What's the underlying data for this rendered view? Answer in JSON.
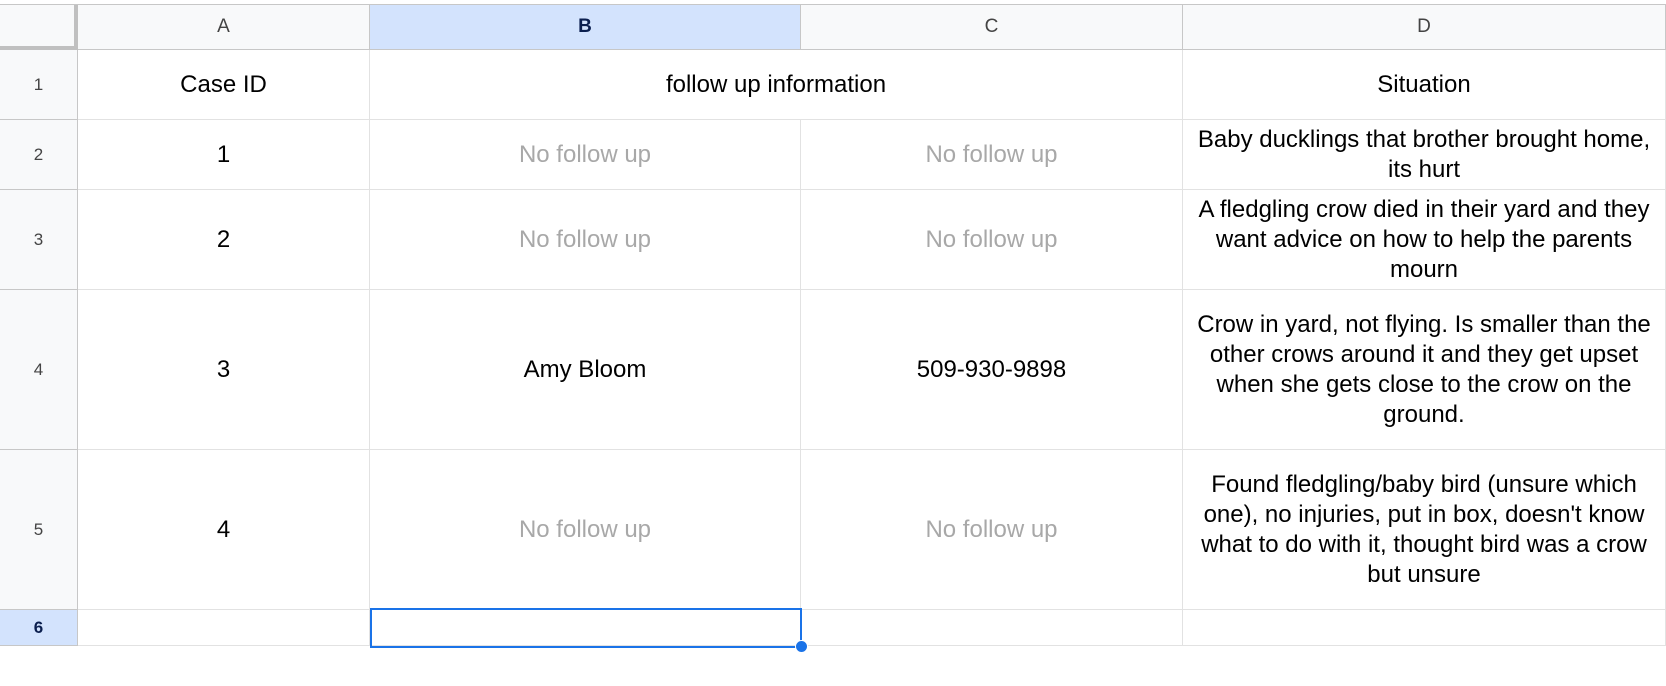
{
  "columns": [
    "A",
    "B",
    "C",
    "D"
  ],
  "rows": [
    "1",
    "2",
    "3",
    "4",
    "5",
    "6"
  ],
  "selected_column": "B",
  "selected_row": "6",
  "cells": {
    "r1": {
      "a": "Case ID",
      "bc": "follow up information",
      "d": "Situation"
    },
    "r2": {
      "a": "1",
      "b": "No follow up",
      "c": "No follow up",
      "d": "Baby ducklings that brother brought home, its hurt"
    },
    "r3": {
      "a": "2",
      "b": "No follow up",
      "c": "No follow up",
      "d": "A fledgling crow died in their yard and they want advice on how to help the parents mourn"
    },
    "r4": {
      "a": "3",
      "b": "Amy Bloom",
      "c": "509-930-9898",
      "d": "Crow in yard, not flying. Is smaller than the other crows around it and they get upset when she gets close to the crow on the ground."
    },
    "r5": {
      "a": "4",
      "b": "No follow up",
      "c": "No follow up",
      "d": "Found fledgling/baby bird (unsure which one), no injuries, put in box, doesn't know what to do with it, thought bird was a crow but unsure"
    }
  },
  "colors": {
    "selection": "#1a73e8",
    "header_selected": "#d3e3fd",
    "placeholder_text": "#a8a8a8"
  }
}
